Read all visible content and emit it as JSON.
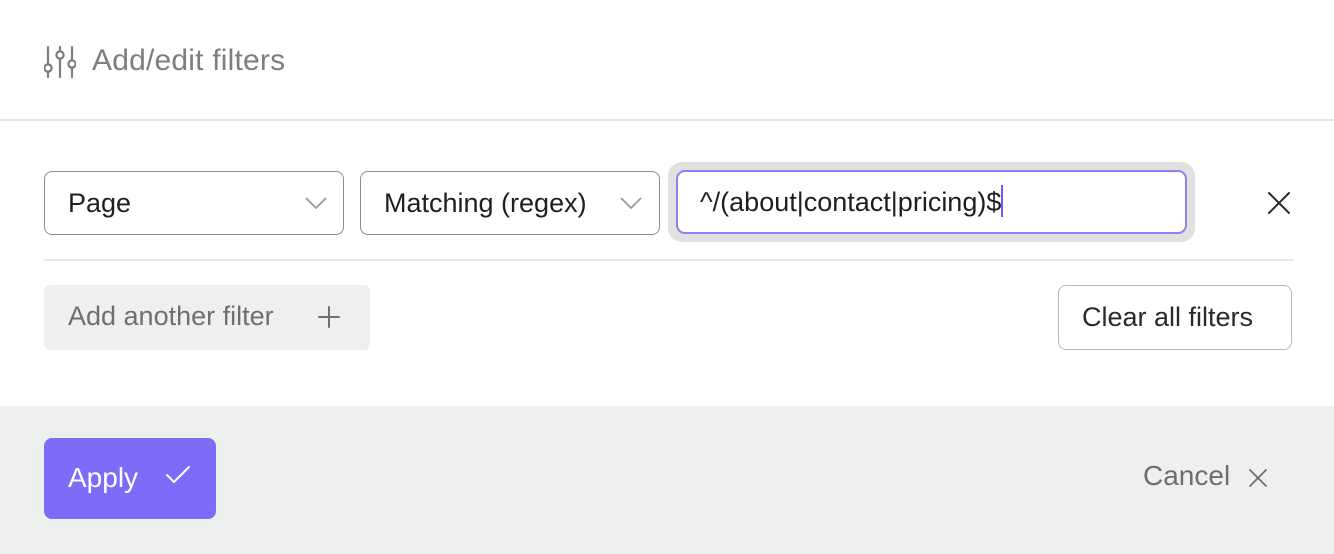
{
  "header": {
    "title": "Add/edit filters",
    "icon": "sliders-icon"
  },
  "filter": {
    "field": {
      "value": "Page"
    },
    "operator": {
      "value": "Matching (regex)"
    },
    "pattern": {
      "value": "^/(about|contact|pricing)$"
    }
  },
  "actions": {
    "add_label": "Add another filter",
    "clear_label": "Clear all filters"
  },
  "footer": {
    "apply_label": "Apply",
    "cancel_label": "Cancel"
  },
  "colors": {
    "accent": "#7c6cf8",
    "focus_border": "#8d82ee",
    "footer_bg": "#eef0ed"
  }
}
